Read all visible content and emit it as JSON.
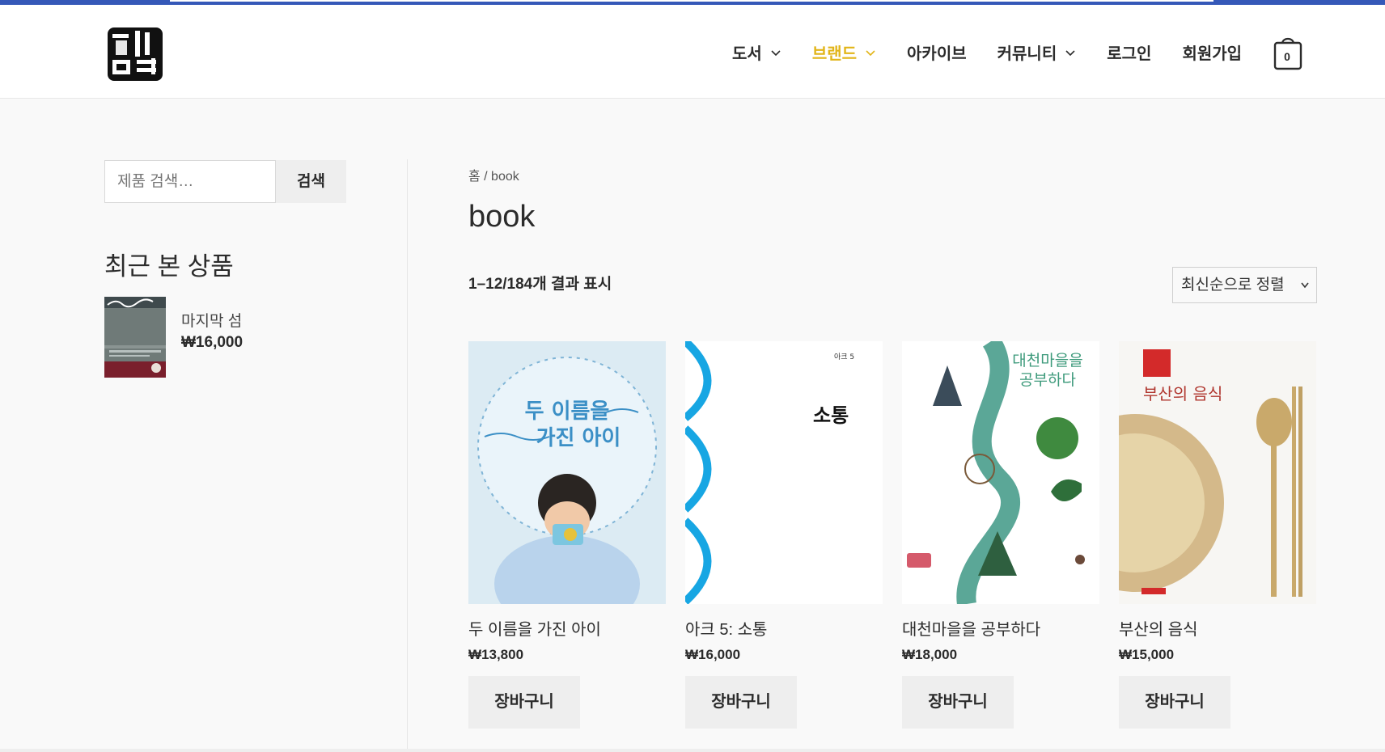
{
  "header": {
    "nav": [
      {
        "label": "도서",
        "has_dropdown": true,
        "active": false
      },
      {
        "label": "브랜드",
        "has_dropdown": true,
        "active": true
      },
      {
        "label": "아카이브",
        "has_dropdown": false,
        "active": false
      },
      {
        "label": "커뮤니티",
        "has_dropdown": true,
        "active": false
      },
      {
        "label": "로그인",
        "has_dropdown": false,
        "active": false
      },
      {
        "label": "회원가입",
        "has_dropdown": false,
        "active": false
      }
    ],
    "cart_count": "0",
    "accent_color": "#e2b519"
  },
  "sidebar": {
    "search": {
      "placeholder": "제품 검색…",
      "button_label": "검색"
    },
    "recent": {
      "title": "최근 본 상품",
      "items": [
        {
          "name": "마지막 섬",
          "price": "₩16,000"
        }
      ]
    }
  },
  "main": {
    "breadcrumb": "홈 / book",
    "title": "book",
    "result_count": "1–12/184개 결과 표시",
    "sort": {
      "selected": "최신순으로 정렬"
    },
    "products": [
      {
        "title": "두 이름을 가진 아이",
        "price": "₩13,800",
        "button": "장바구니",
        "cover_text": [
          "두 이름을",
          "가진 아이"
        ]
      },
      {
        "title": "아크 5: 소통",
        "price": "₩16,000",
        "button": "장바구니",
        "cover_text": [
          "아크 5",
          "소통"
        ]
      },
      {
        "title": "대천마을을 공부하다",
        "price": "₩18,000",
        "button": "장바구니",
        "cover_text": [
          "대천마을을",
          "공부하다"
        ]
      },
      {
        "title": "부산의 음식",
        "price": "₩15,000",
        "button": "장바구니",
        "cover_text": [
          "부산의 음식"
        ]
      }
    ]
  }
}
